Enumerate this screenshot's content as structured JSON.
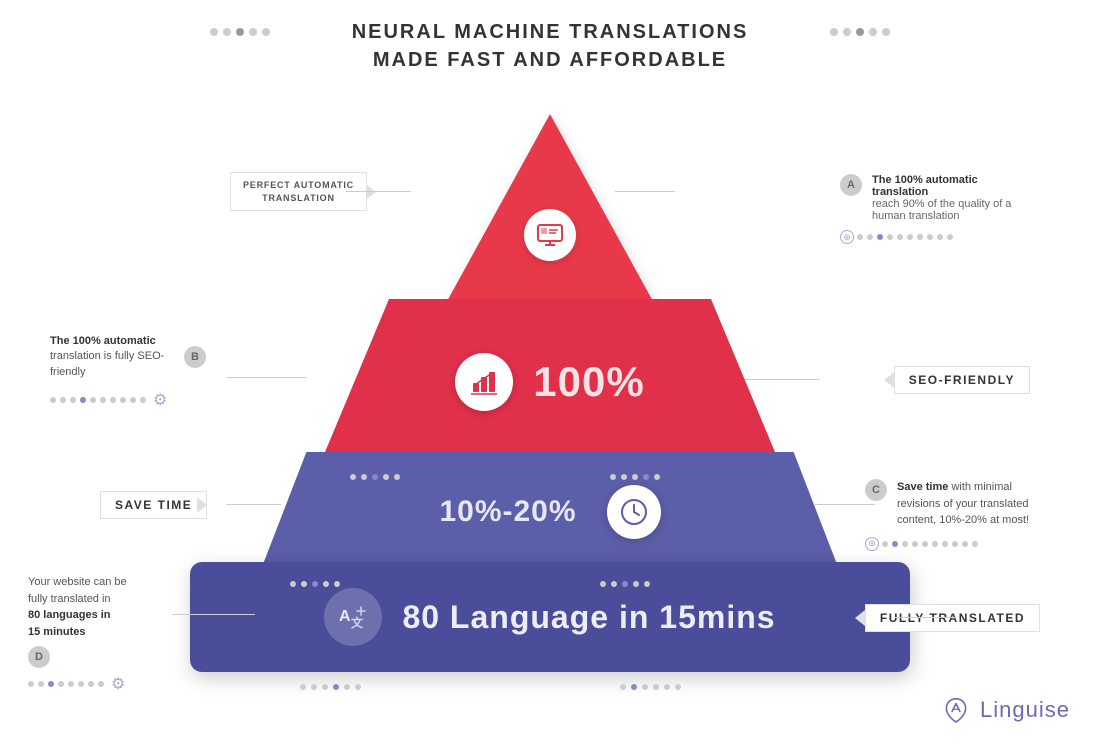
{
  "title": {
    "line1": "NEURAL MACHINE TRANSLATIONS",
    "line2": "MADE FAST AND AFFORDABLE"
  },
  "tier1": {
    "label": "PERFECT AUTOMATIC\nTRANSLATION",
    "annotation_letter": "A",
    "annotation_bold": "The 100% automatic translation",
    "annotation_text": "reach 90% of the quality of a human translation"
  },
  "tier2": {
    "percent": "100%",
    "label_left_bold": "The 100% automatic",
    "label_left": "translation is fully SEO-friendly",
    "annotation_letter": "B",
    "label_right": "SEO-FRIENDLY"
  },
  "tier3": {
    "percent": "10%-20%",
    "label_left": "SAVE TIME",
    "annotation_letter": "C",
    "annotation_bold": "Save time",
    "annotation_text": "with minimal revisions of your translated content, 10%-20% at most!"
  },
  "tier4": {
    "text": "80 Language in 15mins",
    "label_left_line1": "Your website can be",
    "label_left_line2": "fully translated in",
    "label_left_bold": "80 languages in",
    "label_left_line3": "15 minutes",
    "annotation_letter": "D",
    "label_right": "FULLY TRANSLATED"
  },
  "logo": {
    "name": "Linguise"
  },
  "dots": {
    "title_left": [
      "gray",
      "gray",
      "gray",
      "gray",
      "gray"
    ],
    "title_right": [
      "gray",
      "gray",
      "gray",
      "gray",
      "gray"
    ]
  }
}
